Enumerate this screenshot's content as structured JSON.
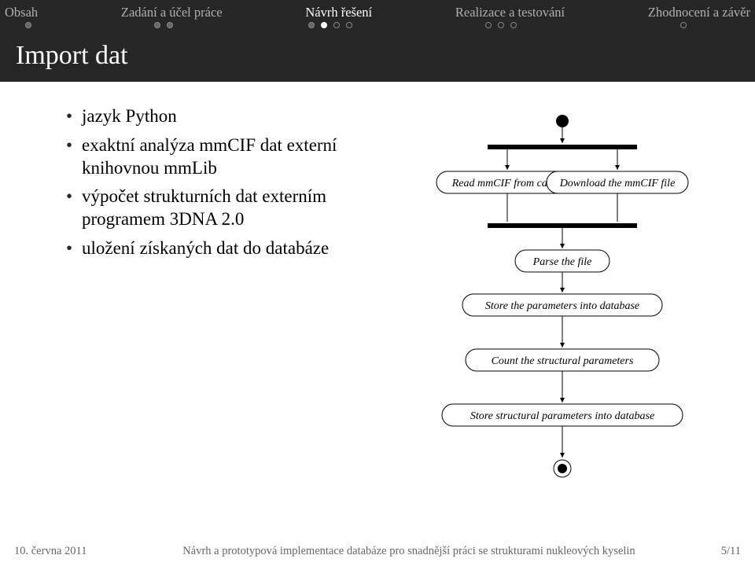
{
  "nav": {
    "items": [
      {
        "label": "Obsah",
        "dots": [
          "gray"
        ]
      },
      {
        "label": "Zadání a účel práce",
        "dots": [
          "gray",
          "gray"
        ]
      },
      {
        "label": "Návrh řešení",
        "dots": [
          "gray",
          "fill",
          "open",
          "open"
        ],
        "current": true
      },
      {
        "label": "Realizace a testování",
        "dots": [
          "open",
          "open",
          "open"
        ]
      },
      {
        "label": "Zhodnocení a závěr",
        "dots": [
          "open"
        ]
      }
    ]
  },
  "title": "Import dat",
  "bullets": [
    "jazyk Python",
    "exaktní analýza mmCIF dat externí knihovnou mmLib",
    "výpočet strukturních dat externím programem 3DNA 2.0",
    "uložení získaných dat do databáze"
  ],
  "diagram": {
    "read_cache": "Read mmCIF from cache",
    "download": "Download the mmCIF file",
    "parse": "Parse the file",
    "store_params": "Store the parameters into database",
    "count": "Count the structural parameters",
    "store_struct": "Store structural parameters into database"
  },
  "footer": {
    "date": "10. června 2011",
    "title": "Návrh a prototypová implementace databáze pro snadnější práci se strukturami nukleových kyselin",
    "page": "5/11"
  }
}
